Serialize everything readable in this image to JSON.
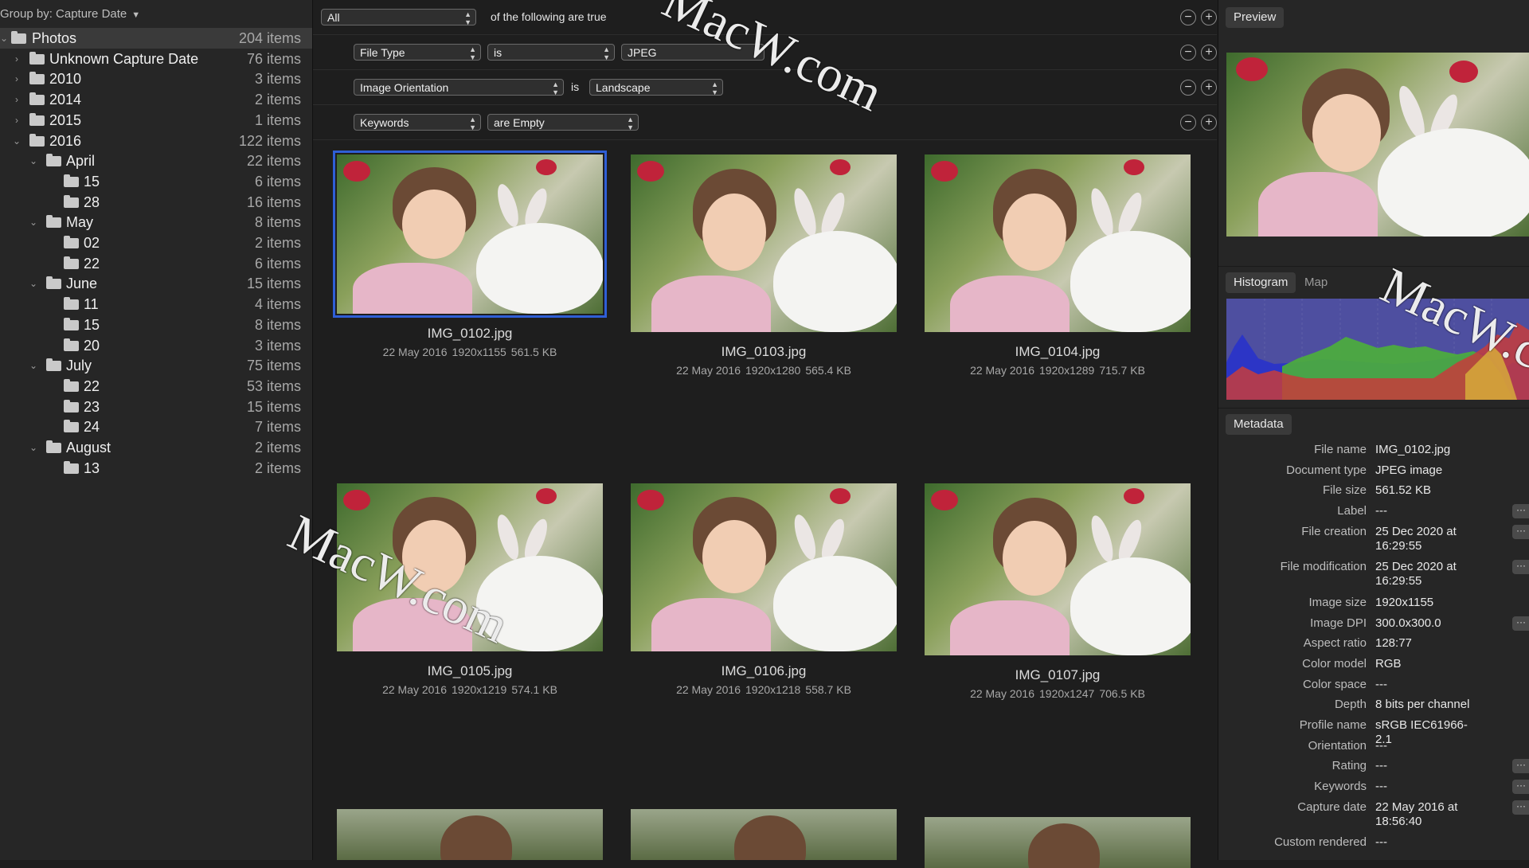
{
  "sidebar": {
    "group_by_label": "Group by: Capture Date",
    "items": [
      {
        "label": "Photos",
        "count": "204 items",
        "level": 0,
        "chevron": "down",
        "selected": true
      },
      {
        "label": "Unknown Capture Date",
        "count": "76 items",
        "level": 1,
        "chevron": "right"
      },
      {
        "label": "2010",
        "count": "3 items",
        "level": 1,
        "chevron": "right"
      },
      {
        "label": "2014",
        "count": "2 items",
        "level": 1,
        "chevron": "right"
      },
      {
        "label": "2015",
        "count": "1 items",
        "level": 1,
        "chevron": "right"
      },
      {
        "label": "2016",
        "count": "122 items",
        "level": 1,
        "chevron": "down"
      },
      {
        "label": "April",
        "count": "22 items",
        "level": 2,
        "chevron": "down"
      },
      {
        "label": "15",
        "count": "6 items",
        "level": 3,
        "chevron": "none"
      },
      {
        "label": "28",
        "count": "16 items",
        "level": 3,
        "chevron": "none"
      },
      {
        "label": "May",
        "count": "8 items",
        "level": 2,
        "chevron": "down"
      },
      {
        "label": "02",
        "count": "2 items",
        "level": 3,
        "chevron": "none"
      },
      {
        "label": "22",
        "count": "6 items",
        "level": 3,
        "chevron": "none"
      },
      {
        "label": "June",
        "count": "15 items",
        "level": 2,
        "chevron": "down"
      },
      {
        "label": "11",
        "count": "4 items",
        "level": 3,
        "chevron": "none"
      },
      {
        "label": "15",
        "count": "8 items",
        "level": 3,
        "chevron": "none"
      },
      {
        "label": "20",
        "count": "3 items",
        "level": 3,
        "chevron": "none"
      },
      {
        "label": "July",
        "count": "75 items",
        "level": 2,
        "chevron": "down"
      },
      {
        "label": "22",
        "count": "53 items",
        "level": 3,
        "chevron": "none"
      },
      {
        "label": "23",
        "count": "15 items",
        "level": 3,
        "chevron": "none"
      },
      {
        "label": "24",
        "count": "7 items",
        "level": 3,
        "chevron": "none"
      },
      {
        "label": "August",
        "count": "2 items",
        "level": 2,
        "chevron": "down"
      },
      {
        "label": "13",
        "count": "2 items",
        "level": 3,
        "chevron": "none"
      }
    ]
  },
  "filters": {
    "match_value": "All",
    "match_suffix": "of the following are true",
    "rules": [
      {
        "field": "File Type",
        "operator": "is",
        "value": "JPEG"
      },
      {
        "field": "Image Orientation",
        "connector": "is",
        "value": "Landscape"
      },
      {
        "field": "Keywords",
        "operator": "are Empty"
      }
    ]
  },
  "thumbnails": [
    {
      "name": "IMG_0102.jpg",
      "date": "22 May 2016",
      "dims": "1920x1155",
      "size": "561.5 KB",
      "selected": true
    },
    {
      "name": "IMG_0103.jpg",
      "date": "22 May 2016",
      "dims": "1920x1280",
      "size": "565.4 KB"
    },
    {
      "name": "IMG_0104.jpg",
      "date": "22 May 2016",
      "dims": "1920x1289",
      "size": "715.7 KB"
    },
    {
      "name": "IMG_0105.jpg",
      "date": "22 May 2016",
      "dims": "1920x1219",
      "size": "574.1 KB"
    },
    {
      "name": "IMG_0106.jpg",
      "date": "22 May 2016",
      "dims": "1920x1218",
      "size": "558.7 KB"
    },
    {
      "name": "IMG_0107.jpg",
      "date": "22 May 2016",
      "dims": "1920x1247",
      "size": "706.5 KB"
    }
  ],
  "inspector": {
    "preview_label": "Preview",
    "histogram_tab": "Histogram",
    "map_tab": "Map",
    "metadata_label": "Metadata",
    "metadata": [
      {
        "key": "File name",
        "value": "IMG_0102.jpg"
      },
      {
        "key": "Document type",
        "value": "JPEG image"
      },
      {
        "key": "File size",
        "value": "561.52 KB"
      },
      {
        "key": "Label",
        "value": "---",
        "more": true
      },
      {
        "key": "File creation",
        "value": "25 Dec 2020 at 16:29:55",
        "more": true
      },
      {
        "key": "File modification",
        "value": "25 Dec 2020 at 16:29:55",
        "more": true
      },
      {
        "key": "Image size",
        "value": "1920x1155"
      },
      {
        "key": "Image DPI",
        "value": "300.0x300.0",
        "more": true
      },
      {
        "key": "Aspect ratio",
        "value": "128:77"
      },
      {
        "key": "Color model",
        "value": "RGB"
      },
      {
        "key": "Color space",
        "value": "---"
      },
      {
        "key": "Depth",
        "value": "8 bits per channel"
      },
      {
        "key": "Profile name",
        "value": "sRGB IEC61966-2.1"
      },
      {
        "key": "Orientation",
        "value": "---"
      },
      {
        "key": "Rating",
        "value": "---",
        "more": true
      },
      {
        "key": "Keywords",
        "value": "---",
        "more": true
      },
      {
        "key": "Capture date",
        "value": "22 May 2016 at 18:56:40",
        "more": true
      },
      {
        "key": "Custom rendered",
        "value": "---"
      }
    ]
  },
  "watermark": "MacW.com",
  "colors": {
    "selection": "#2f5fd6",
    "histogram_bg": "#4e4fa0",
    "histogram_green": "#4caf3a",
    "histogram_red": "#c73c3c",
    "histogram_blue": "#2a34c8"
  },
  "icons": {
    "folder": "folder-icon",
    "chevron_right": "chevron-right-icon",
    "chevron_down": "chevron-down-icon",
    "minus": "remove-rule-icon",
    "plus": "add-rule-icon",
    "more": "more-icon"
  }
}
